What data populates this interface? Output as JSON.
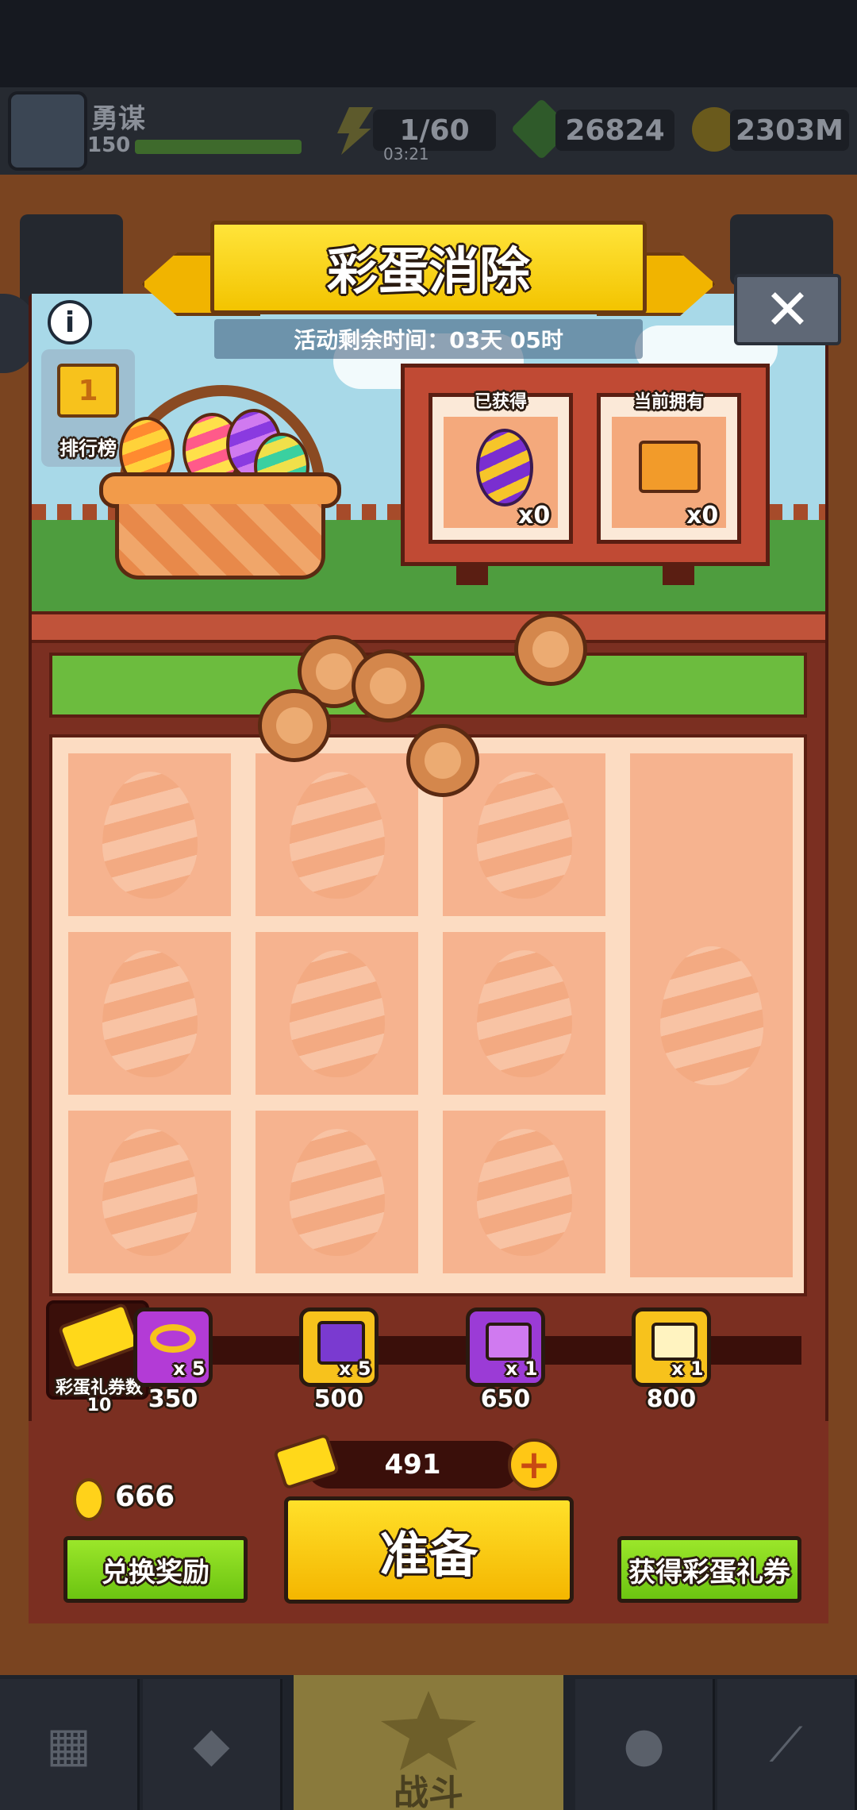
{
  "hud": {
    "player_name": "勇谋",
    "level": "150",
    "energy": "1/60",
    "energy_timer": "03:21",
    "gems": "26824",
    "gold": "2303M"
  },
  "event": {
    "title": "彩蛋消除",
    "timer_text": "活动剩余时间：03天 05时",
    "info_label": "i",
    "leaderboard_label": "排行榜",
    "leaderboard_rank": "1",
    "obtained": {
      "title": "已获得",
      "count": "x0"
    },
    "owned": {
      "title": "当前拥有",
      "count": "x0"
    }
  },
  "rewards": {
    "current_label": "彩蛋礼券数",
    "current_value": "10",
    "items": [
      {
        "qty": "x 5",
        "cost": "350",
        "icon": "key-icon",
        "color": "#b33bd6"
      },
      {
        "qty": "x 5",
        "cost": "500",
        "icon": "puzzle-icon",
        "color": "#f7c21c"
      },
      {
        "qty": "x 1",
        "cost": "650",
        "icon": "purple-chest-icon",
        "color": "#9b3bd6"
      },
      {
        "qty": "x 1",
        "cost": "800",
        "icon": "gold-chest-icon",
        "color": "#f7c21c"
      }
    ]
  },
  "footer": {
    "tickets": "491",
    "eggs": "666",
    "exchange_label": "兑换奖励",
    "ready_label": "准备",
    "get_tickets_label": "获得彩蛋礼券"
  },
  "nav": {
    "battle_label": "战斗"
  }
}
